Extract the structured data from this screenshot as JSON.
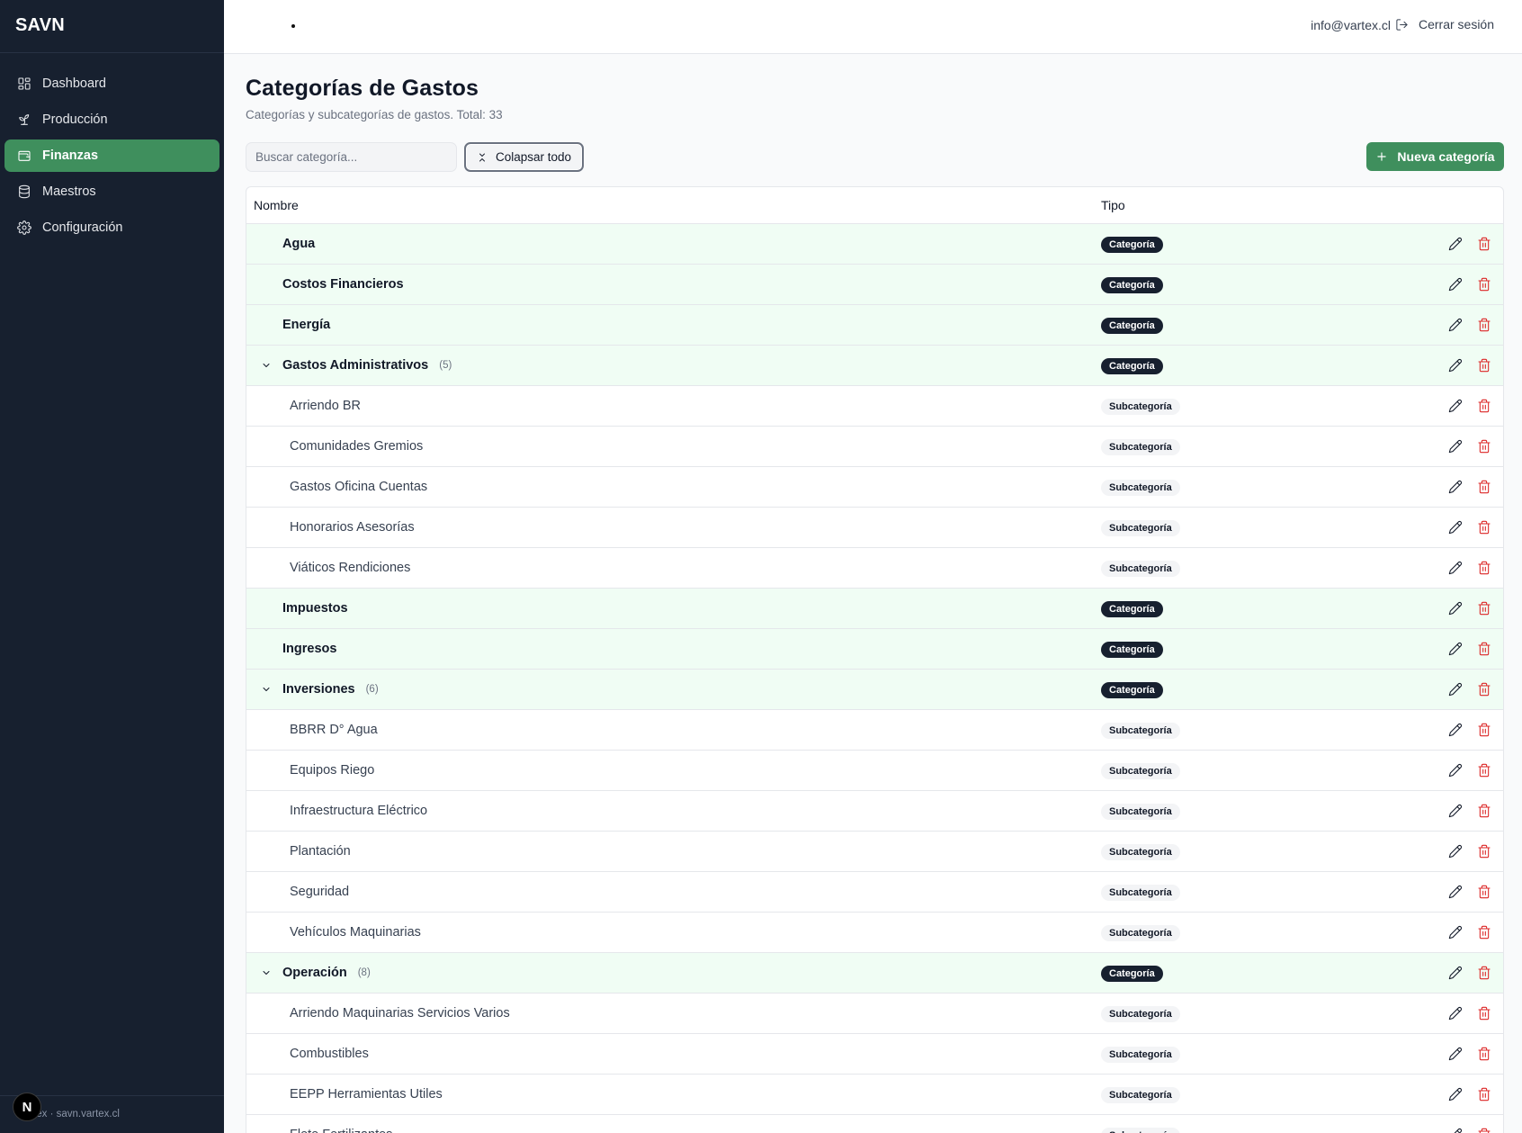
{
  "app": {
    "brand": "SAVN",
    "footer": "Vartex · savn.vartex.cl",
    "next_badge": "N"
  },
  "sidebar": {
    "items": [
      {
        "label": "Dashboard",
        "icon": "layout-grid-icon",
        "active": false
      },
      {
        "label": "Producción",
        "icon": "sprout-icon",
        "active": false
      },
      {
        "label": "Finanzas",
        "icon": "wallet-icon",
        "active": true
      },
      {
        "label": "Maestros",
        "icon": "database-icon",
        "active": false
      },
      {
        "label": "Configuración",
        "icon": "gear-icon",
        "active": false
      }
    ]
  },
  "topbar": {
    "user_email": "info@vartex.cl",
    "logout_label": "Cerrar sesión"
  },
  "page": {
    "title": "Categorías de Gastos",
    "subtitle": "Categorías y subcategorías de gastos. Total: 33"
  },
  "toolbar": {
    "search_placeholder": "Buscar categoría...",
    "collapse_label": "Colapsar todo",
    "new_label": "Nueva categoría"
  },
  "table": {
    "columns": [
      "Nombre",
      "Tipo"
    ],
    "rows": [
      {
        "kind": "cat",
        "name": "Agua",
        "type": "Categoría"
      },
      {
        "kind": "cat",
        "name": "Costos Financieros",
        "type": "Categoría"
      },
      {
        "kind": "cat",
        "name": "Energía",
        "type": "Categoría"
      },
      {
        "kind": "cat",
        "name": "Gastos Administrativos",
        "count": "(5)",
        "expanded": true,
        "type": "Categoría"
      },
      {
        "kind": "sub",
        "name": "Arriendo BR",
        "type": "Subcategoría"
      },
      {
        "kind": "sub",
        "name": "Comunidades Gremios",
        "type": "Subcategoría"
      },
      {
        "kind": "sub",
        "name": "Gastos Oficina Cuentas",
        "type": "Subcategoría"
      },
      {
        "kind": "sub",
        "name": "Honorarios Asesorías",
        "type": "Subcategoría"
      },
      {
        "kind": "sub",
        "name": "Viáticos Rendiciones",
        "type": "Subcategoría"
      },
      {
        "kind": "cat",
        "name": "Impuestos",
        "type": "Categoría"
      },
      {
        "kind": "cat",
        "name": "Ingresos",
        "type": "Categoría"
      },
      {
        "kind": "cat",
        "name": "Inversiones",
        "count": "(6)",
        "expanded": true,
        "type": "Categoría"
      },
      {
        "kind": "sub",
        "name": "BBRR D° Agua",
        "type": "Subcategoría"
      },
      {
        "kind": "sub",
        "name": "Equipos Riego",
        "type": "Subcategoría"
      },
      {
        "kind": "sub",
        "name": "Infraestructura Eléctrico",
        "type": "Subcategoría"
      },
      {
        "kind": "sub",
        "name": "Plantación",
        "type": "Subcategoría"
      },
      {
        "kind": "sub",
        "name": "Seguridad",
        "type": "Subcategoría"
      },
      {
        "kind": "sub",
        "name": "Vehículos Maquinarias",
        "type": "Subcategoría"
      },
      {
        "kind": "cat",
        "name": "Operación",
        "count": "(8)",
        "expanded": true,
        "type": "Categoría"
      },
      {
        "kind": "sub",
        "name": "Arriendo Maquinarias Servicios Varios",
        "type": "Subcategoría"
      },
      {
        "kind": "sub",
        "name": "Combustibles",
        "type": "Subcategoría"
      },
      {
        "kind": "sub",
        "name": "EEPP Herramientas Utiles",
        "type": "Subcategoría"
      },
      {
        "kind": "sub",
        "name": "Flete Fertilizantes",
        "type": "Subcategoría"
      }
    ]
  },
  "colors": {
    "sidebar_bg": "#17202f",
    "accent": "#3f8f5d",
    "category_row_bg": "#f0fdf4",
    "delete": "#dc2626"
  }
}
